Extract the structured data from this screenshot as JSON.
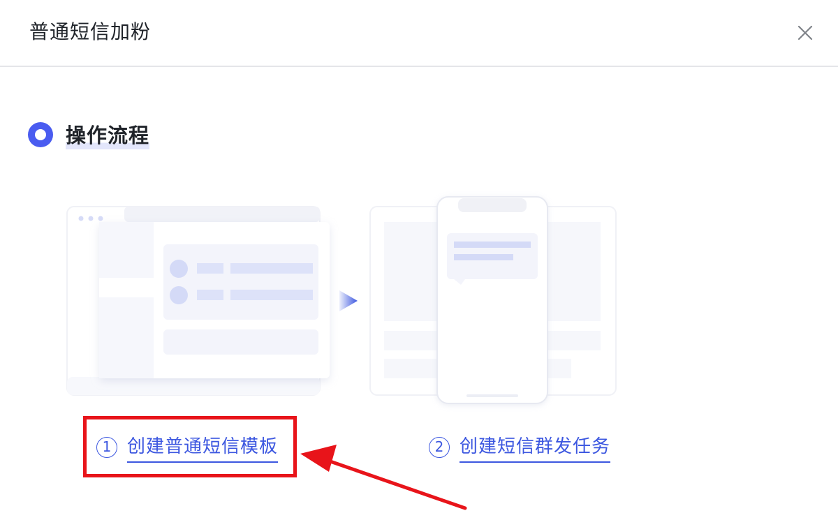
{
  "dialog": {
    "title": "普通短信加粉",
    "close_icon": "close-icon"
  },
  "section": {
    "title": "操作流程",
    "icon": "radio-dot-icon"
  },
  "steps": [
    {
      "number": "1",
      "label": "创建普通短信模板"
    },
    {
      "number": "2",
      "label": "创建短信群发任务"
    }
  ],
  "annotation": {
    "highlight_color": "#e8141a",
    "arrow_color": "#e8141a"
  },
  "colors": {
    "accent": "#3c57e0",
    "radio": "#4a5cf0",
    "illustration_light": "#f4f5fb",
    "illustration_accent": "#d3d9f7"
  }
}
